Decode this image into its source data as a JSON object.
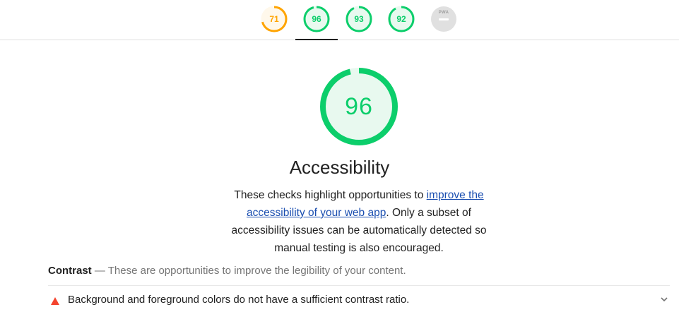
{
  "top_gauges": [
    {
      "value": "71",
      "score": 71,
      "color": "#ffa400",
      "bg": "#fff8eb"
    },
    {
      "value": "96",
      "score": 96,
      "color": "#0cce6b",
      "bg": "#e8f9ef"
    },
    {
      "value": "93",
      "score": 93,
      "color": "#0cce6b",
      "bg": "#e8f9ef"
    },
    {
      "value": "92",
      "score": 92,
      "color": "#0cce6b",
      "bg": "#e8f9ef"
    },
    {
      "label": "PWA",
      "color": "#e0e0e0"
    }
  ],
  "main": {
    "score": "96",
    "score_value": 96,
    "score_color": "#0cce6b",
    "title": "Accessibility",
    "desc_prefix": "These checks highlight opportunities to ",
    "desc_link": "improve the accessibility of your web app",
    "desc_suffix": ". Only a subset of accessibility issues can be automatically detected so manual testing is also encouraged."
  },
  "group": {
    "title": "Contrast",
    "separator": " — ",
    "description": "These are opportunities to improve the legibility of your content."
  },
  "audit": {
    "label": "Background and foreground colors do not have a sufficient contrast ratio.",
    "status_color": "#f4442e",
    "icon": "warning-triangle-icon"
  }
}
